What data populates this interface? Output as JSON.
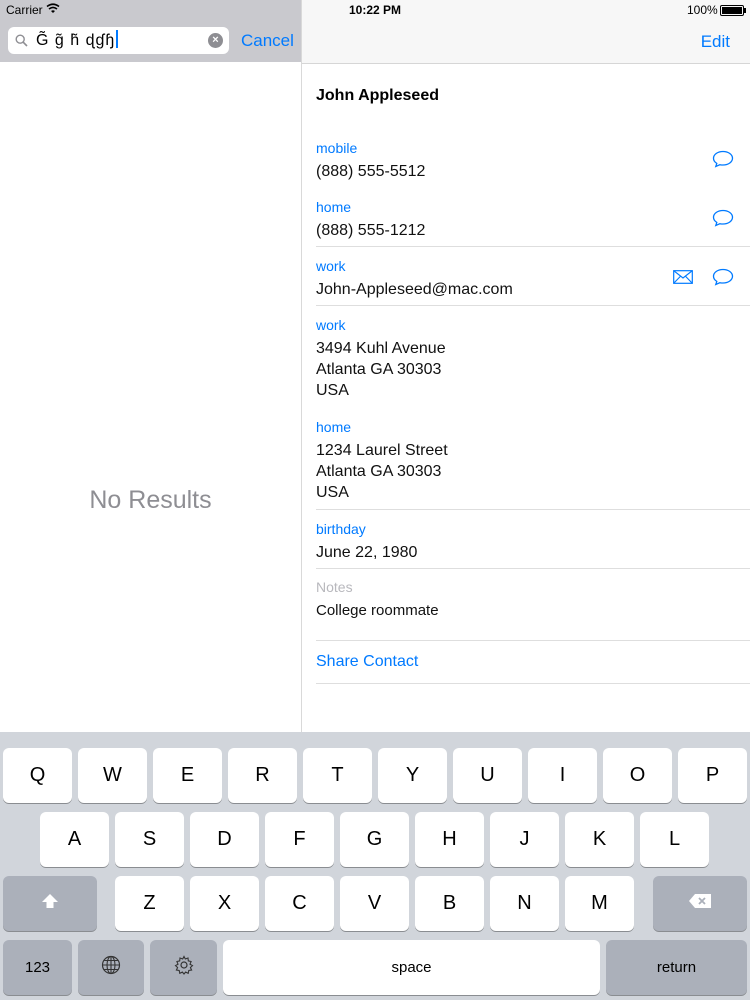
{
  "status_bar": {
    "carrier": "Carrier",
    "time": "10:22 PM",
    "battery": "100%"
  },
  "search": {
    "query": "G̃ g̃ h̃ ɖɠɧ",
    "cancel_label": "Cancel",
    "no_results": "No Results"
  },
  "contact": {
    "edit_label": "Edit",
    "name": "John Appleseed",
    "fields": [
      {
        "label": "mobile",
        "value": "(888) 555-5512"
      },
      {
        "label": "home",
        "value": "(888) 555-1212"
      },
      {
        "label": "work",
        "value": "John-Appleseed@mac.com"
      },
      {
        "label": "work",
        "lines": [
          "3494 Kuhl Avenue",
          "Atlanta GA 30303",
          "USA"
        ]
      },
      {
        "label": "home",
        "lines": [
          "1234 Laurel Street",
          "Atlanta GA 30303",
          "USA"
        ]
      },
      {
        "label": "birthday",
        "value": "June 22, 1980"
      }
    ],
    "notes_label": "Notes",
    "notes_value": "College roommate",
    "share_label": "Share Contact"
  },
  "keyboard": {
    "row1": [
      "Q",
      "W",
      "E",
      "R",
      "T",
      "Y",
      "U",
      "I",
      "O",
      "P"
    ],
    "row2": [
      "A",
      "S",
      "D",
      "F",
      "G",
      "H",
      "J",
      "K",
      "L"
    ],
    "row3": [
      "Z",
      "X",
      "C",
      "V",
      "B",
      "N",
      "M"
    ],
    "numbers_label": "123",
    "space_label": "space",
    "return_label": "return"
  },
  "colors": {
    "accent": "#007aff",
    "keyboard_bg": "#d1d5db",
    "dark_key": "#abb0ba",
    "search_bar_bg": "#c9c9ce"
  }
}
